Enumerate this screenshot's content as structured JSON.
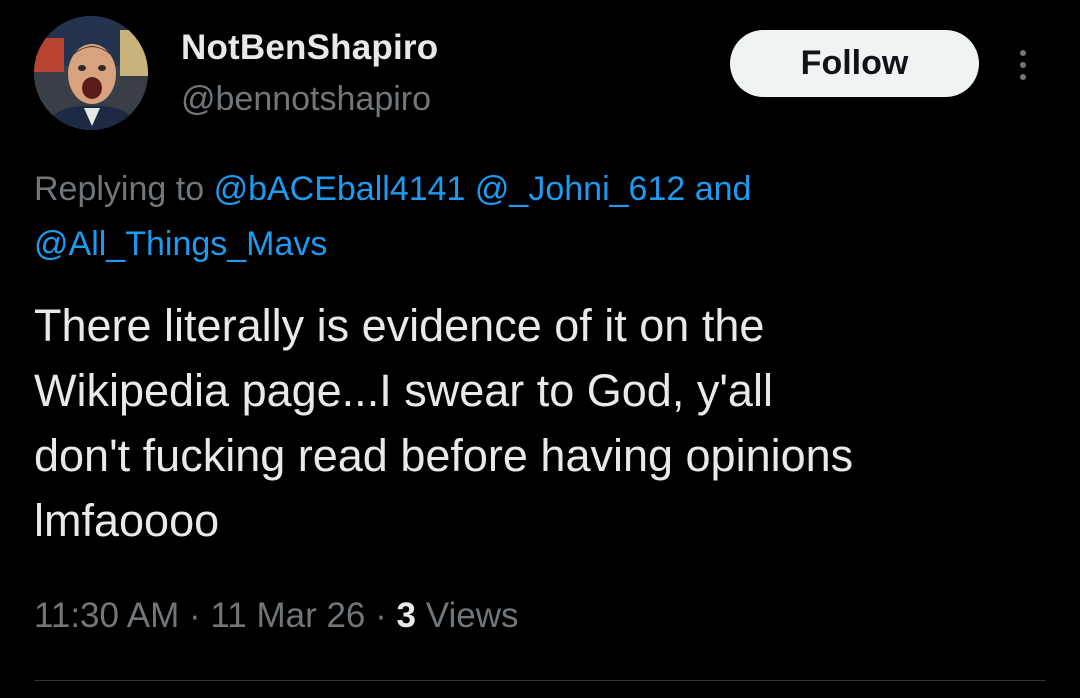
{
  "tweet": {
    "author": {
      "display_name": "NotBenShapiro",
      "handle": "@bennotshapiro"
    },
    "follow_label": "Follow",
    "more_icon": "more-vertical-icon",
    "replying": {
      "prefix": "Replying to",
      "mentions": [
        "@bACEball4141",
        "@_Johni_612"
      ],
      "conjunction": "and",
      "last_mention": "@All_Things_Mavs"
    },
    "text": "There literally is evidence of it on the\nWikipedia page...I swear to God, y'all\ndon't fucking read before having opinions\nlmfaoooo",
    "meta": {
      "time": "11:30 AM",
      "separator": "·",
      "date": "11 Mar 26",
      "views_count": "3",
      "views_label": "Views"
    }
  },
  "colors": {
    "background": "#000000",
    "text_primary": "#e7e9ea",
    "text_secondary": "#71767b",
    "link": "#1d9bf0",
    "follow_button_bg": "#eff3f4",
    "follow_button_text": "#0f1419",
    "divider": "#2f3336"
  }
}
